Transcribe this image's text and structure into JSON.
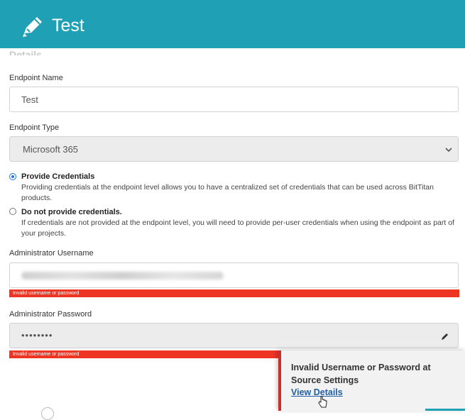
{
  "header": {
    "title": "Test",
    "icon": "pencil-icon"
  },
  "form": {
    "section_heading": "Details",
    "endpoint_name": {
      "label": "Endpoint Name",
      "value": "Test"
    },
    "endpoint_type": {
      "label": "Endpoint Type",
      "value": "Microsoft 365"
    },
    "credentials_options": [
      {
        "title": "Provide Credentials",
        "description": "Providing credentials at the endpoint level allows you to have a centralized set of credentials that can be used across BitTitan products.",
        "selected": true
      },
      {
        "title": "Do not provide credentials.",
        "description": "If credentials are not provided at the endpoint level, you will need to provide per-user credentials when using the endpoint as part of your projects.",
        "selected": false
      }
    ],
    "admin_username": {
      "label": "Administrator Username",
      "error": "Invalid username or password"
    },
    "admin_password": {
      "label": "Administrator Password",
      "value": "••••••••",
      "error": "Invalid username or password"
    }
  },
  "toast": {
    "message": "Invalid Username or Password at Source Settings",
    "link": "View Details",
    "accent_color": "#c9302c"
  },
  "colors": {
    "header": "#1fa0b5",
    "error": "#ee3524",
    "link": "#1f5fa5",
    "radio": "#1a73e8"
  }
}
